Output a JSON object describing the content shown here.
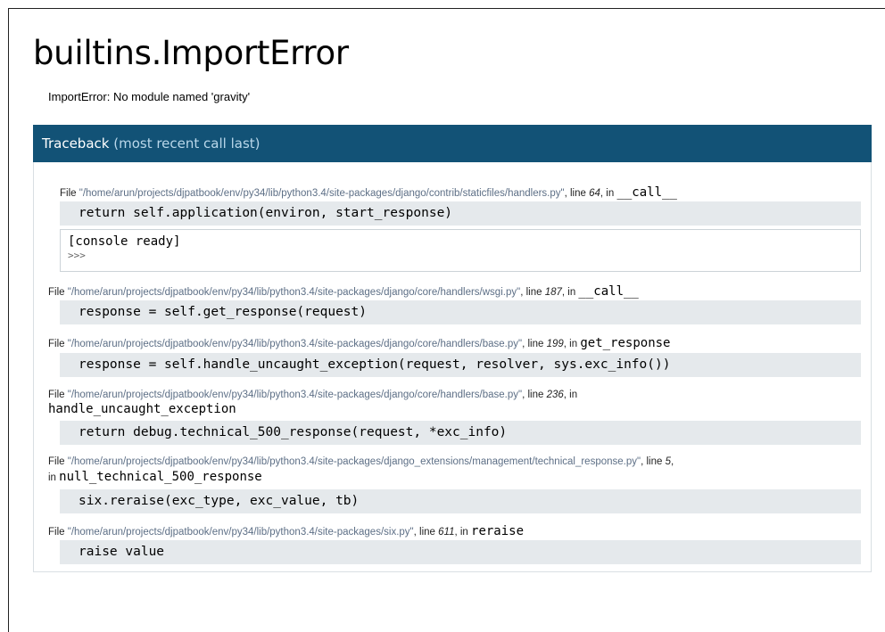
{
  "error": {
    "title": "builtins.ImportError",
    "message": "ImportError: No module named 'gravity'"
  },
  "traceback": {
    "heading": "Traceback",
    "subheading": "(most recent call last)",
    "file_prefix": "File",
    "line_prefix": ", line",
    "in_prefix": ", in",
    "in_prefix_wrapped": "in",
    "frames": [
      {
        "path": "\"/home/arun/projects/djpatbook/env/py34/lib/python3.4/site-packages/django/contrib/staticfiles/handlers.py\"",
        "line": "64",
        "function": "__call__",
        "code": "return self.application(environ, start_response)"
      },
      {
        "path": "\"/home/arun/projects/djpatbook/env/py34/lib/python3.4/site-packages/django/core/handlers/wsgi.py\"",
        "line": "187",
        "function": "__call__",
        "code": "response = self.get_response(request)"
      },
      {
        "path": "\"/home/arun/projects/djpatbook/env/py34/lib/python3.4/site-packages/django/core/handlers/base.py\"",
        "line": "199",
        "function": "get_response",
        "code": "response = self.handle_uncaught_exception(request, resolver, sys.exc_info())"
      },
      {
        "path": "\"/home/arun/projects/djpatbook/env/py34/lib/python3.4/site-packages/django/core/handlers/base.py\"",
        "line": "236",
        "function": "handle_uncaught_exception",
        "code": "return debug.technical_500_response(request, *exc_info)"
      },
      {
        "path": "\"/home/arun/projects/djpatbook/env/py34/lib/python3.4/site-packages/django_extensions/management/technical_response.py\"",
        "line": "5",
        "function": "null_technical_500_response",
        "code": "six.reraise(exc_type, exc_value, tb)"
      },
      {
        "path": "\"/home/arun/projects/djpatbook/env/py34/lib/python3.4/site-packages/six.py\"",
        "line": "611",
        "function": "reraise",
        "code": "raise value"
      }
    ]
  },
  "console": {
    "status": "[console ready]",
    "prompt": ">>>"
  },
  "colors": {
    "header_bg": "#125276",
    "code_bg": "#e5e9ec",
    "path_text": "#5d6f86"
  }
}
